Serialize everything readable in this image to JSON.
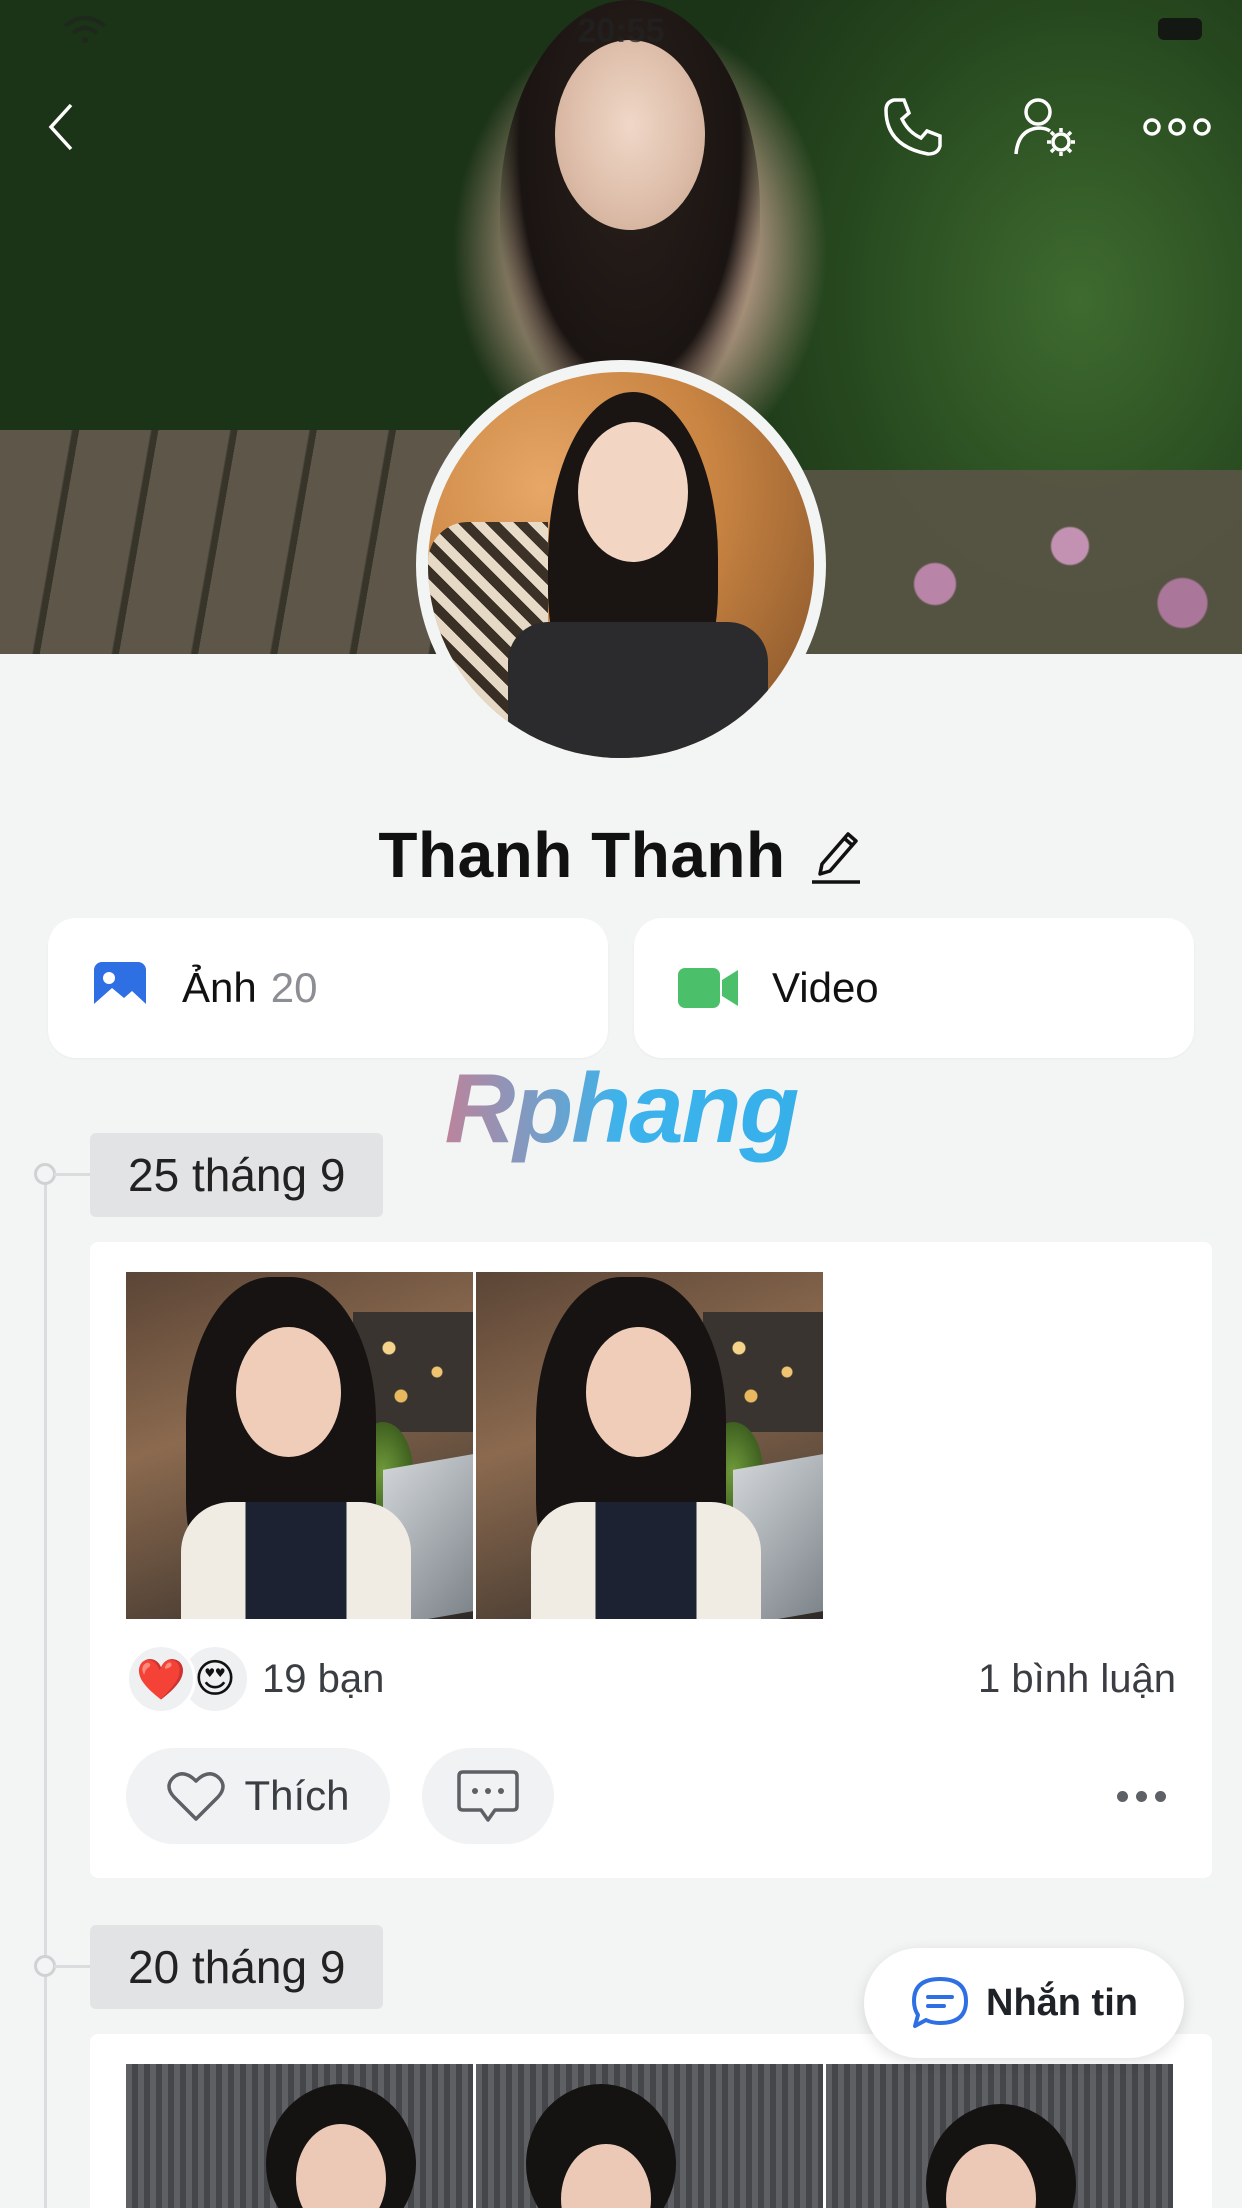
{
  "status_bar": {
    "time": "20:55"
  },
  "profile": {
    "name": "Thanh Thanh"
  },
  "media": {
    "photos_label": "Ảnh",
    "photos_count": "20",
    "video_label": "Video"
  },
  "watermark": "Rphang",
  "posts": [
    {
      "date": "25 tháng 9",
      "reaction_emojis": [
        "❤️",
        "😍"
      ],
      "friends_reacted": "19 bạn",
      "comments": "1 bình luận",
      "like_label": "Thích"
    },
    {
      "date": "20 tháng 9"
    }
  ],
  "message_button": {
    "label": "Nhắn tin"
  },
  "colors": {
    "photo_icon": "#2f6fe4",
    "video_icon": "#4cbf6a",
    "chat_icon": "#2f6fe4",
    "background": "#f3f4f4"
  }
}
